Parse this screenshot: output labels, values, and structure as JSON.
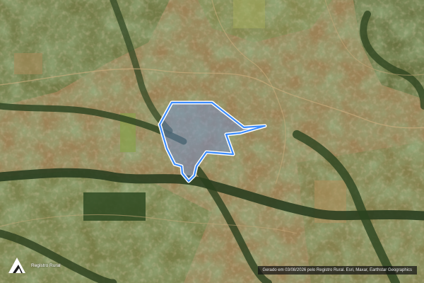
{
  "map": {
    "basemap": "satellite",
    "boundary": {
      "stroke_color": "#3b8cff",
      "halo_color": "#ffffff",
      "fill_color": "#6f8fd6"
    }
  },
  "footer": {
    "brand_name": "Registro Rural",
    "brand_icon": "registro-rural-logo",
    "attribution": "Gerado em 03/08/2026 pelo Registro Rural. Esri, Maxar, Earthstar Geographics"
  }
}
